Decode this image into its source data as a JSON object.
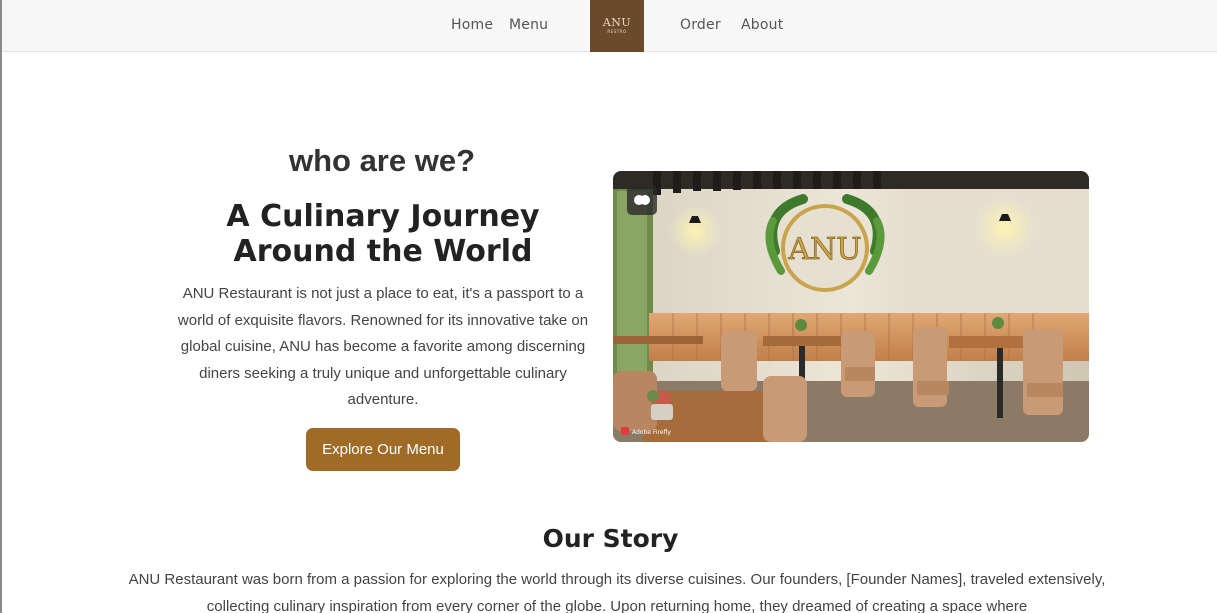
{
  "nav": {
    "home": "Home",
    "menu": "Menu",
    "order": "Order",
    "about": "About",
    "logo_main": "ANU",
    "logo_sub": "RESTRO"
  },
  "hero": {
    "eyebrow": "who are we?",
    "title": "A Culinary Journey Around the World",
    "paragraph": "ANU Restaurant is not just a place to eat, it's a passport to a world of exquisite flavors. Renowned for its innovative take on global cuisine, ANU has become a favorite among discerning diners seeking a truly unique and unforgettable culinary adventure.",
    "cta_label": "Explore Our Menu",
    "image": {
      "wall_sign": "ANU",
      "watermark": "Adobe Firefly"
    }
  },
  "story": {
    "title": "Our Story",
    "paragraph": "ANU Restaurant was born from a passion for exploring the world through its diverse cuisines. Our founders, [Founder Names], traveled extensively, collecting culinary inspiration from every corner of the globe. Upon returning home, they dreamed of creating a space where"
  },
  "colors": {
    "accent": "#a06b26",
    "logo_bg": "#6b4a2b",
    "nav_bg": "#f7f7f8"
  }
}
